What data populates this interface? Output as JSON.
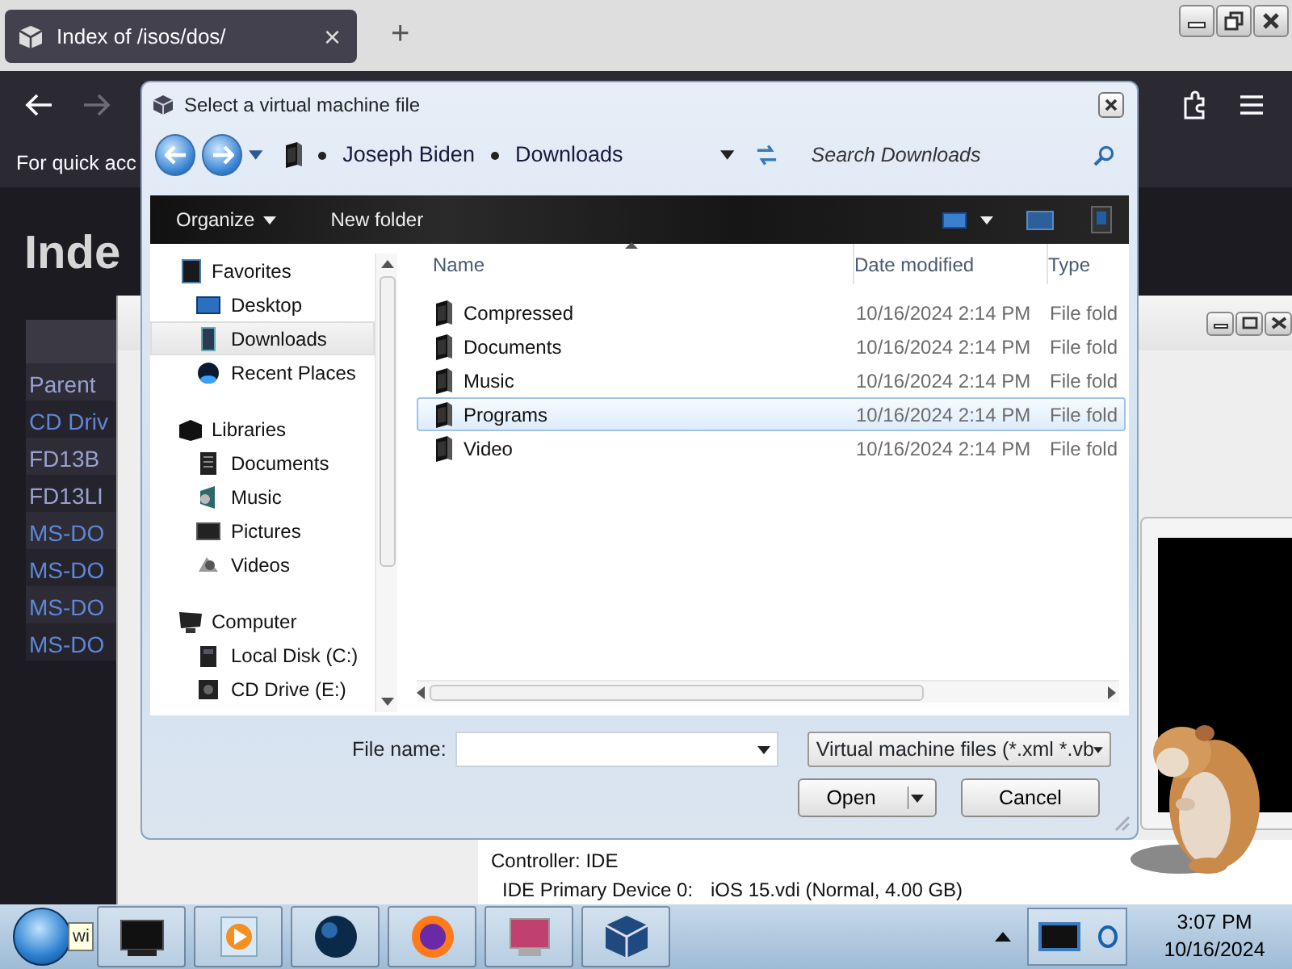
{
  "browser": {
    "tab": {
      "title": "Index of /isos/dos/",
      "close": "×"
    },
    "new_tab": "+",
    "bookmarks_hint": "For quick acc",
    "heading": "Inde",
    "listing": [
      {
        "text": "Parent",
        "kind": "parent"
      },
      {
        "text": "CD Driv",
        "kind": "link"
      },
      {
        "text": "FD13B",
        "kind": "parent"
      },
      {
        "text": "FD13LI",
        "kind": "parent"
      },
      {
        "text": "MS-DO",
        "kind": "link"
      },
      {
        "text": "MS-DO",
        "kind": "link"
      },
      {
        "text": "MS-DO",
        "kind": "link"
      },
      {
        "text": "MS-DO",
        "kind": "link"
      }
    ]
  },
  "vm_window": {
    "controller": "Controller: IDE",
    "device_label": "IDE Primary Device 0:",
    "device_value": "iOS 15.vdi (Normal, 4.00 GB)"
  },
  "dialog": {
    "title": "Select a virtual machine file",
    "breadcrumb": [
      "Joseph Biden",
      "Downloads"
    ],
    "search": {
      "placeholder": "Search Downloads"
    },
    "toolbar": [
      "Organize",
      "New folder"
    ],
    "nav": [
      {
        "label": "Favorites",
        "children": [
          {
            "label": "Desktop",
            "selected": false
          },
          {
            "label": "Downloads",
            "selected": true
          },
          {
            "label": "Recent Places",
            "selected": false
          }
        ]
      },
      {
        "label": "Libraries",
        "children": [
          {
            "label": "Documents",
            "selected": false
          },
          {
            "label": "Music",
            "selected": false
          },
          {
            "label": "Pictures",
            "selected": false
          },
          {
            "label": "Videos",
            "selected": false
          }
        ]
      },
      {
        "label": "Computer",
        "children": [
          {
            "label": "Local Disk (C:)",
            "selected": false
          },
          {
            "label": "CD Drive (E:)",
            "selected": false
          }
        ]
      }
    ],
    "columns": [
      "Name",
      "Date modified",
      "Type"
    ],
    "rows": [
      {
        "name": "Compressed",
        "date": "10/16/2024 2:14 PM",
        "type": "File fold",
        "selected": false
      },
      {
        "name": "Documents",
        "date": "10/16/2024 2:14 PM",
        "type": "File fold",
        "selected": false
      },
      {
        "name": "Music",
        "date": "10/16/2024 2:14 PM",
        "type": "File fold",
        "selected": false
      },
      {
        "name": "Programs",
        "date": "10/16/2024 2:14 PM",
        "type": "File fold",
        "selected": true
      },
      {
        "name": "Video",
        "date": "10/16/2024 2:14 PM",
        "type": "File fold",
        "selected": false
      }
    ],
    "file_name_label": "File name:",
    "file_type": "Virtual machine files (*.xml *.vb",
    "buttons": [
      "Open",
      "Cancel"
    ]
  },
  "taskbar": {
    "tooltip": "wi",
    "time": "3:07 PM",
    "date": "10/16/2024"
  }
}
